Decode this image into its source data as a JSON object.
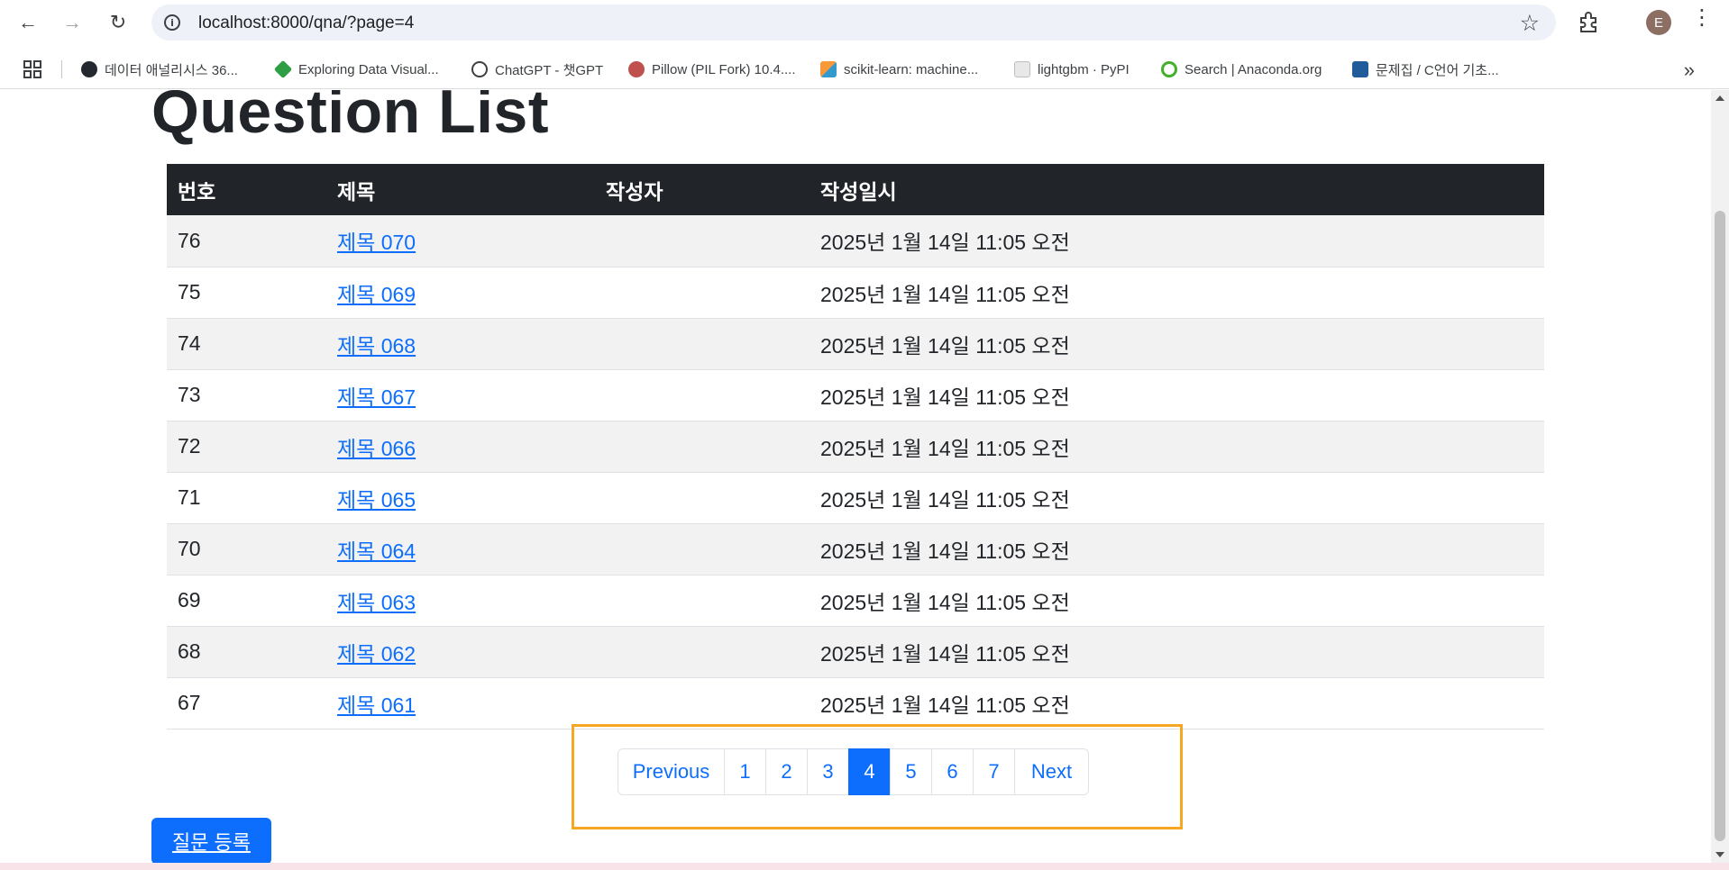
{
  "browser": {
    "url": "localhost:8000/qna/?page=4",
    "profile_initial": "E",
    "bookmarks": [
      {
        "label": "데이터 애널리시스 36...",
        "icon": "github-icon"
      },
      {
        "label": "Exploring Data Visual...",
        "icon": "green-diamond-icon"
      },
      {
        "label": "ChatGPT - 챗GPT",
        "icon": "openai-icon"
      },
      {
        "label": "Pillow (PIL Fork) 10.4....",
        "icon": "pillow-icon"
      },
      {
        "label": "scikit-learn: machine...",
        "icon": "scikit-learn-icon"
      },
      {
        "label": "lightgbm · PyPI",
        "icon": "pypi-icon"
      },
      {
        "label": "Search | Anaconda.org",
        "icon": "anaconda-icon"
      },
      {
        "label": "문제집 / C언어 기초...",
        "icon": "codeup-icon"
      }
    ]
  },
  "page": {
    "title": "Question List",
    "table": {
      "headers": [
        "번호",
        "제목",
        "작성자",
        "작성일시"
      ],
      "rows": [
        {
          "num": "76",
          "subject": "제목 070",
          "author": "",
          "date": "2025년 1월 14일 11:05 오전"
        },
        {
          "num": "75",
          "subject": "제목 069",
          "author": "",
          "date": "2025년 1월 14일 11:05 오전"
        },
        {
          "num": "74",
          "subject": "제목 068",
          "author": "",
          "date": "2025년 1월 14일 11:05 오전"
        },
        {
          "num": "73",
          "subject": "제목 067",
          "author": "",
          "date": "2025년 1월 14일 11:05 오전"
        },
        {
          "num": "72",
          "subject": "제목 066",
          "author": "",
          "date": "2025년 1월 14일 11:05 오전"
        },
        {
          "num": "71",
          "subject": "제목 065",
          "author": "",
          "date": "2025년 1월 14일 11:05 오전"
        },
        {
          "num": "70",
          "subject": "제목 064",
          "author": "",
          "date": "2025년 1월 14일 11:05 오전"
        },
        {
          "num": "69",
          "subject": "제목 063",
          "author": "",
          "date": "2025년 1월 14일 11:05 오전"
        },
        {
          "num": "68",
          "subject": "제목 062",
          "author": "",
          "date": "2025년 1월 14일 11:05 오전"
        },
        {
          "num": "67",
          "subject": "제목 061",
          "author": "",
          "date": "2025년 1월 14일 11:05 오전"
        }
      ]
    },
    "pagination": {
      "previous": "Previous",
      "pages": [
        "1",
        "2",
        "3",
        "4",
        "5",
        "6",
        "7"
      ],
      "current": "4",
      "next": "Next"
    },
    "register_button": "질문 등록"
  },
  "colors": {
    "primary": "#0d6efd",
    "header_dark": "#212529",
    "highlight": "#f5a623"
  }
}
